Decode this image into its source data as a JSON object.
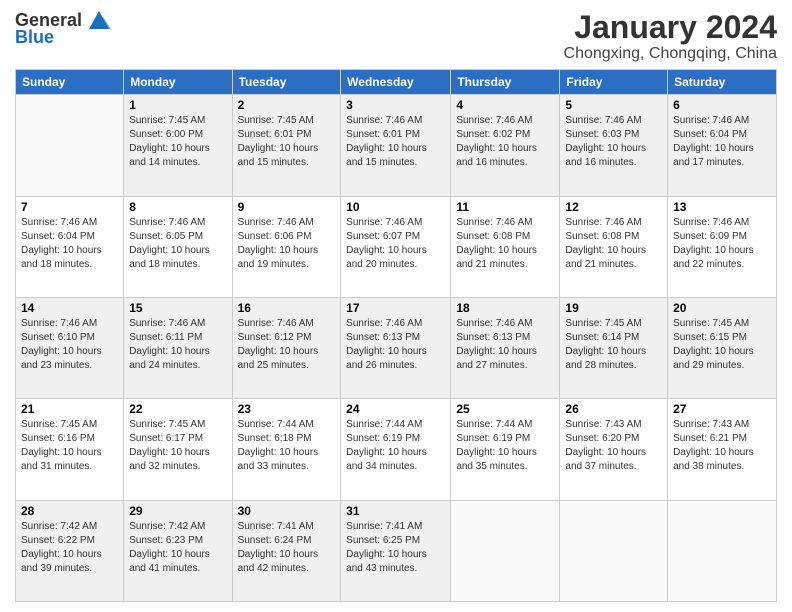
{
  "header": {
    "logo_general": "General",
    "logo_blue": "Blue",
    "month_title": "January 2024",
    "location": "Chongxing, Chongqing, China"
  },
  "weekdays": [
    "Sunday",
    "Monday",
    "Tuesday",
    "Wednesday",
    "Thursday",
    "Friday",
    "Saturday"
  ],
  "weeks": [
    [
      {
        "day": "",
        "sunrise": "",
        "sunset": "",
        "daylight": ""
      },
      {
        "day": "1",
        "sunrise": "Sunrise: 7:45 AM",
        "sunset": "Sunset: 6:00 PM",
        "daylight": "Daylight: 10 hours and 14 minutes."
      },
      {
        "day": "2",
        "sunrise": "Sunrise: 7:45 AM",
        "sunset": "Sunset: 6:01 PM",
        "daylight": "Daylight: 10 hours and 15 minutes."
      },
      {
        "day": "3",
        "sunrise": "Sunrise: 7:46 AM",
        "sunset": "Sunset: 6:01 PM",
        "daylight": "Daylight: 10 hours and 15 minutes."
      },
      {
        "day": "4",
        "sunrise": "Sunrise: 7:46 AM",
        "sunset": "Sunset: 6:02 PM",
        "daylight": "Daylight: 10 hours and 16 minutes."
      },
      {
        "day": "5",
        "sunrise": "Sunrise: 7:46 AM",
        "sunset": "Sunset: 6:03 PM",
        "daylight": "Daylight: 10 hours and 16 minutes."
      },
      {
        "day": "6",
        "sunrise": "Sunrise: 7:46 AM",
        "sunset": "Sunset: 6:04 PM",
        "daylight": "Daylight: 10 hours and 17 minutes."
      }
    ],
    [
      {
        "day": "7",
        "sunrise": "Sunrise: 7:46 AM",
        "sunset": "Sunset: 6:04 PM",
        "daylight": "Daylight: 10 hours and 18 minutes."
      },
      {
        "day": "8",
        "sunrise": "Sunrise: 7:46 AM",
        "sunset": "Sunset: 6:05 PM",
        "daylight": "Daylight: 10 hours and 18 minutes."
      },
      {
        "day": "9",
        "sunrise": "Sunrise: 7:46 AM",
        "sunset": "Sunset: 6:06 PM",
        "daylight": "Daylight: 10 hours and 19 minutes."
      },
      {
        "day": "10",
        "sunrise": "Sunrise: 7:46 AM",
        "sunset": "Sunset: 6:07 PM",
        "daylight": "Daylight: 10 hours and 20 minutes."
      },
      {
        "day": "11",
        "sunrise": "Sunrise: 7:46 AM",
        "sunset": "Sunset: 6:08 PM",
        "daylight": "Daylight: 10 hours and 21 minutes."
      },
      {
        "day": "12",
        "sunrise": "Sunrise: 7:46 AM",
        "sunset": "Sunset: 6:08 PM",
        "daylight": "Daylight: 10 hours and 21 minutes."
      },
      {
        "day": "13",
        "sunrise": "Sunrise: 7:46 AM",
        "sunset": "Sunset: 6:09 PM",
        "daylight": "Daylight: 10 hours and 22 minutes."
      }
    ],
    [
      {
        "day": "14",
        "sunrise": "Sunrise: 7:46 AM",
        "sunset": "Sunset: 6:10 PM",
        "daylight": "Daylight: 10 hours and 23 minutes."
      },
      {
        "day": "15",
        "sunrise": "Sunrise: 7:46 AM",
        "sunset": "Sunset: 6:11 PM",
        "daylight": "Daylight: 10 hours and 24 minutes."
      },
      {
        "day": "16",
        "sunrise": "Sunrise: 7:46 AM",
        "sunset": "Sunset: 6:12 PM",
        "daylight": "Daylight: 10 hours and 25 minutes."
      },
      {
        "day": "17",
        "sunrise": "Sunrise: 7:46 AM",
        "sunset": "Sunset: 6:13 PM",
        "daylight": "Daylight: 10 hours and 26 minutes."
      },
      {
        "day": "18",
        "sunrise": "Sunrise: 7:46 AM",
        "sunset": "Sunset: 6:13 PM",
        "daylight": "Daylight: 10 hours and 27 minutes."
      },
      {
        "day": "19",
        "sunrise": "Sunrise: 7:45 AM",
        "sunset": "Sunset: 6:14 PM",
        "daylight": "Daylight: 10 hours and 28 minutes."
      },
      {
        "day": "20",
        "sunrise": "Sunrise: 7:45 AM",
        "sunset": "Sunset: 6:15 PM",
        "daylight": "Daylight: 10 hours and 29 minutes."
      }
    ],
    [
      {
        "day": "21",
        "sunrise": "Sunrise: 7:45 AM",
        "sunset": "Sunset: 6:16 PM",
        "daylight": "Daylight: 10 hours and 31 minutes."
      },
      {
        "day": "22",
        "sunrise": "Sunrise: 7:45 AM",
        "sunset": "Sunset: 6:17 PM",
        "daylight": "Daylight: 10 hours and 32 minutes."
      },
      {
        "day": "23",
        "sunrise": "Sunrise: 7:44 AM",
        "sunset": "Sunset: 6:18 PM",
        "daylight": "Daylight: 10 hours and 33 minutes."
      },
      {
        "day": "24",
        "sunrise": "Sunrise: 7:44 AM",
        "sunset": "Sunset: 6:19 PM",
        "daylight": "Daylight: 10 hours and 34 minutes."
      },
      {
        "day": "25",
        "sunrise": "Sunrise: 7:44 AM",
        "sunset": "Sunset: 6:19 PM",
        "daylight": "Daylight: 10 hours and 35 minutes."
      },
      {
        "day": "26",
        "sunrise": "Sunrise: 7:43 AM",
        "sunset": "Sunset: 6:20 PM",
        "daylight": "Daylight: 10 hours and 37 minutes."
      },
      {
        "day": "27",
        "sunrise": "Sunrise: 7:43 AM",
        "sunset": "Sunset: 6:21 PM",
        "daylight": "Daylight: 10 hours and 38 minutes."
      }
    ],
    [
      {
        "day": "28",
        "sunrise": "Sunrise: 7:42 AM",
        "sunset": "Sunset: 6:22 PM",
        "daylight": "Daylight: 10 hours and 39 minutes."
      },
      {
        "day": "29",
        "sunrise": "Sunrise: 7:42 AM",
        "sunset": "Sunset: 6:23 PM",
        "daylight": "Daylight: 10 hours and 41 minutes."
      },
      {
        "day": "30",
        "sunrise": "Sunrise: 7:41 AM",
        "sunset": "Sunset: 6:24 PM",
        "daylight": "Daylight: 10 hours and 42 minutes."
      },
      {
        "day": "31",
        "sunrise": "Sunrise: 7:41 AM",
        "sunset": "Sunset: 6:25 PM",
        "daylight": "Daylight: 10 hours and 43 minutes."
      },
      {
        "day": "",
        "sunrise": "",
        "sunset": "",
        "daylight": ""
      },
      {
        "day": "",
        "sunrise": "",
        "sunset": "",
        "daylight": ""
      },
      {
        "day": "",
        "sunrise": "",
        "sunset": "",
        "daylight": ""
      }
    ]
  ]
}
